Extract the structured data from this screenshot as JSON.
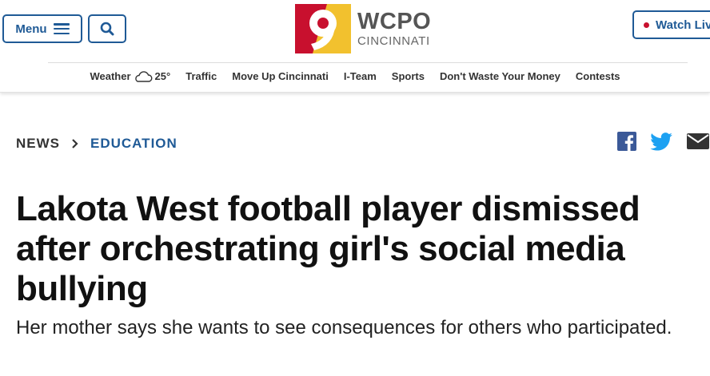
{
  "header": {
    "menu_label": "Menu",
    "watch_label": "Watch Live",
    "logo": {
      "number": "9",
      "name": "WCPO",
      "city": "CINCINNATI"
    }
  },
  "nav": {
    "weather": {
      "label": "Weather",
      "temp": "25°",
      "icon": "cloud-icon"
    },
    "items": [
      "Traffic",
      "Move Up Cincinnati",
      "I-Team",
      "Sports",
      "Don't Waste Your Money",
      "Contests"
    ]
  },
  "breadcrumb": {
    "section": "NEWS",
    "subsection": "EDUCATION"
  },
  "share": {
    "icons": [
      "facebook-icon",
      "twitter-icon",
      "email-icon"
    ],
    "facebook_color": "#3b5998",
    "twitter_color": "#1da1f2",
    "email_color": "#333333"
  },
  "article": {
    "headline": "Lakota West football player dismissed after orchestrating girl's social media bullying",
    "subhead": "Her mother says she wants to see consequences for others who participated."
  },
  "colors": {
    "accent": "#1f5a96",
    "logo_red": "#c8102e",
    "logo_yellow": "#f2c12e",
    "live_dot": "#c8102e"
  }
}
